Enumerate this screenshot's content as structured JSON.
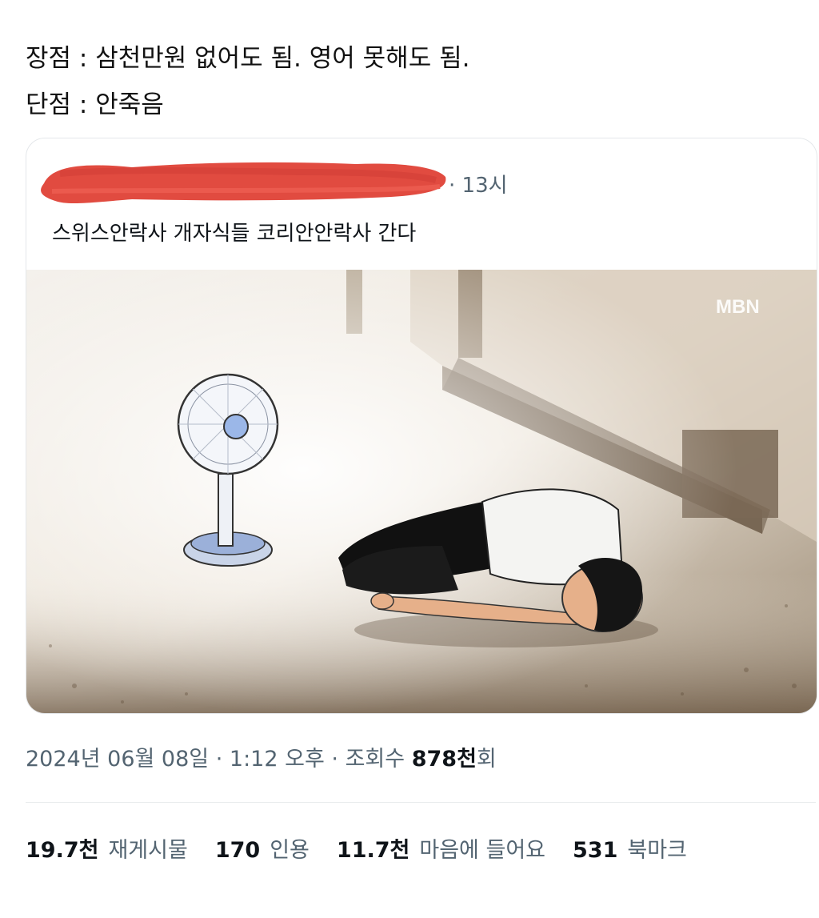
{
  "tweet": {
    "line1": "장점 : 삼천만원 없어도 됨. 영어 못해도 됨.",
    "line2": "단점 : 안죽음"
  },
  "quote": {
    "time": "· 13시",
    "text": "스위스안락사 개자식들 코리안안락사 간다",
    "watermark": "MBN"
  },
  "meta": {
    "date": "2024년 06월 08일",
    "time": "1:12 오후",
    "views_label": "조회수",
    "views_value": "878천",
    "views_suffix": "회",
    "separator": "·"
  },
  "stats": {
    "reposts_value": "19.7천",
    "reposts_label": "재게시물",
    "quotes_value": "170",
    "quotes_label": "인용",
    "likes_value": "11.7천",
    "likes_label": "마음에 들어요",
    "bookmarks_value": "531",
    "bookmarks_label": "북마크"
  }
}
